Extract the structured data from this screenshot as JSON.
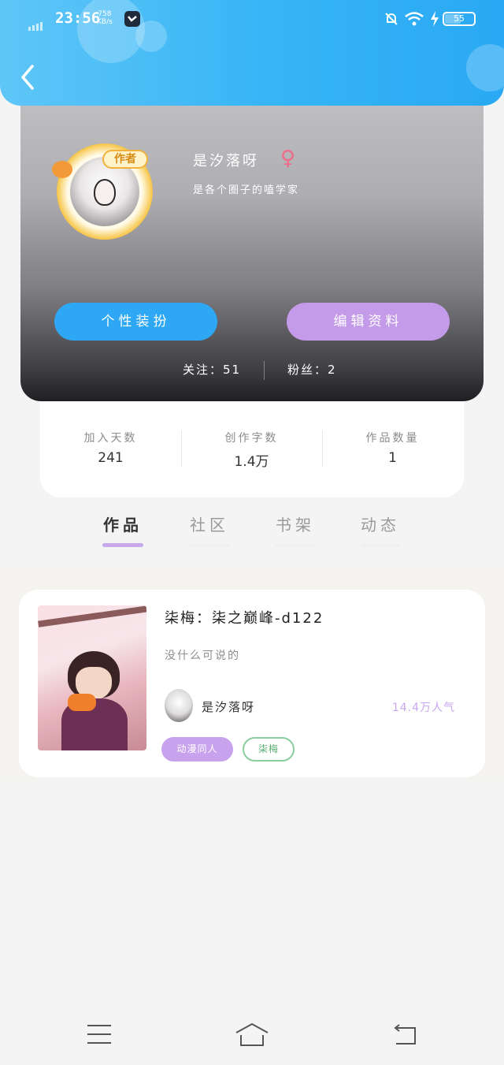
{
  "status_bar": {
    "time": "23:56",
    "net_speed_value": "758",
    "net_speed_unit": "KB/s",
    "battery": "55",
    "battery_level": 0.55
  },
  "profile": {
    "avatar_badge": "作者",
    "name": "是汐落呀",
    "gender_symbol": "♀",
    "bio": "是各个圈子的嗑学家",
    "buttons": {
      "dress_up": "个性装扮",
      "edit_profile": "编辑资料"
    },
    "follow_text": "关注：51",
    "fans_text": "粉丝：2"
  },
  "stats": [
    {
      "label": "加入天数",
      "value": "241"
    },
    {
      "label": "创作字数",
      "value": "1.4万"
    },
    {
      "label": "作品数量",
      "value": "1"
    }
  ],
  "tabs": [
    {
      "label": "作品",
      "active": true
    },
    {
      "label": "社区",
      "active": false
    },
    {
      "label": "书架",
      "active": false
    },
    {
      "label": "动态",
      "active": false
    }
  ],
  "works": [
    {
      "title": "柒梅：柒之巅峰-d122",
      "description": "没什么可说的",
      "author": "是汐落呀",
      "popularity": "14.4万人气",
      "tags": [
        "动漫同人",
        "柒梅"
      ]
    }
  ],
  "colors": {
    "header_blue": "#35b4f6",
    "button_blue": "#2ea7f4",
    "button_purple": "#c49be8",
    "tab_indicator": "#c7a8ec",
    "popularity": "#c9a6ee",
    "tag_purple": "#c8a2ec",
    "tag_green": "#8ccd9f"
  },
  "icons": {
    "back": "chevron-left-icon",
    "gender": "female-icon",
    "nav_menu": "menu-icon",
    "nav_home": "home-icon",
    "nav_back": "return-icon"
  }
}
